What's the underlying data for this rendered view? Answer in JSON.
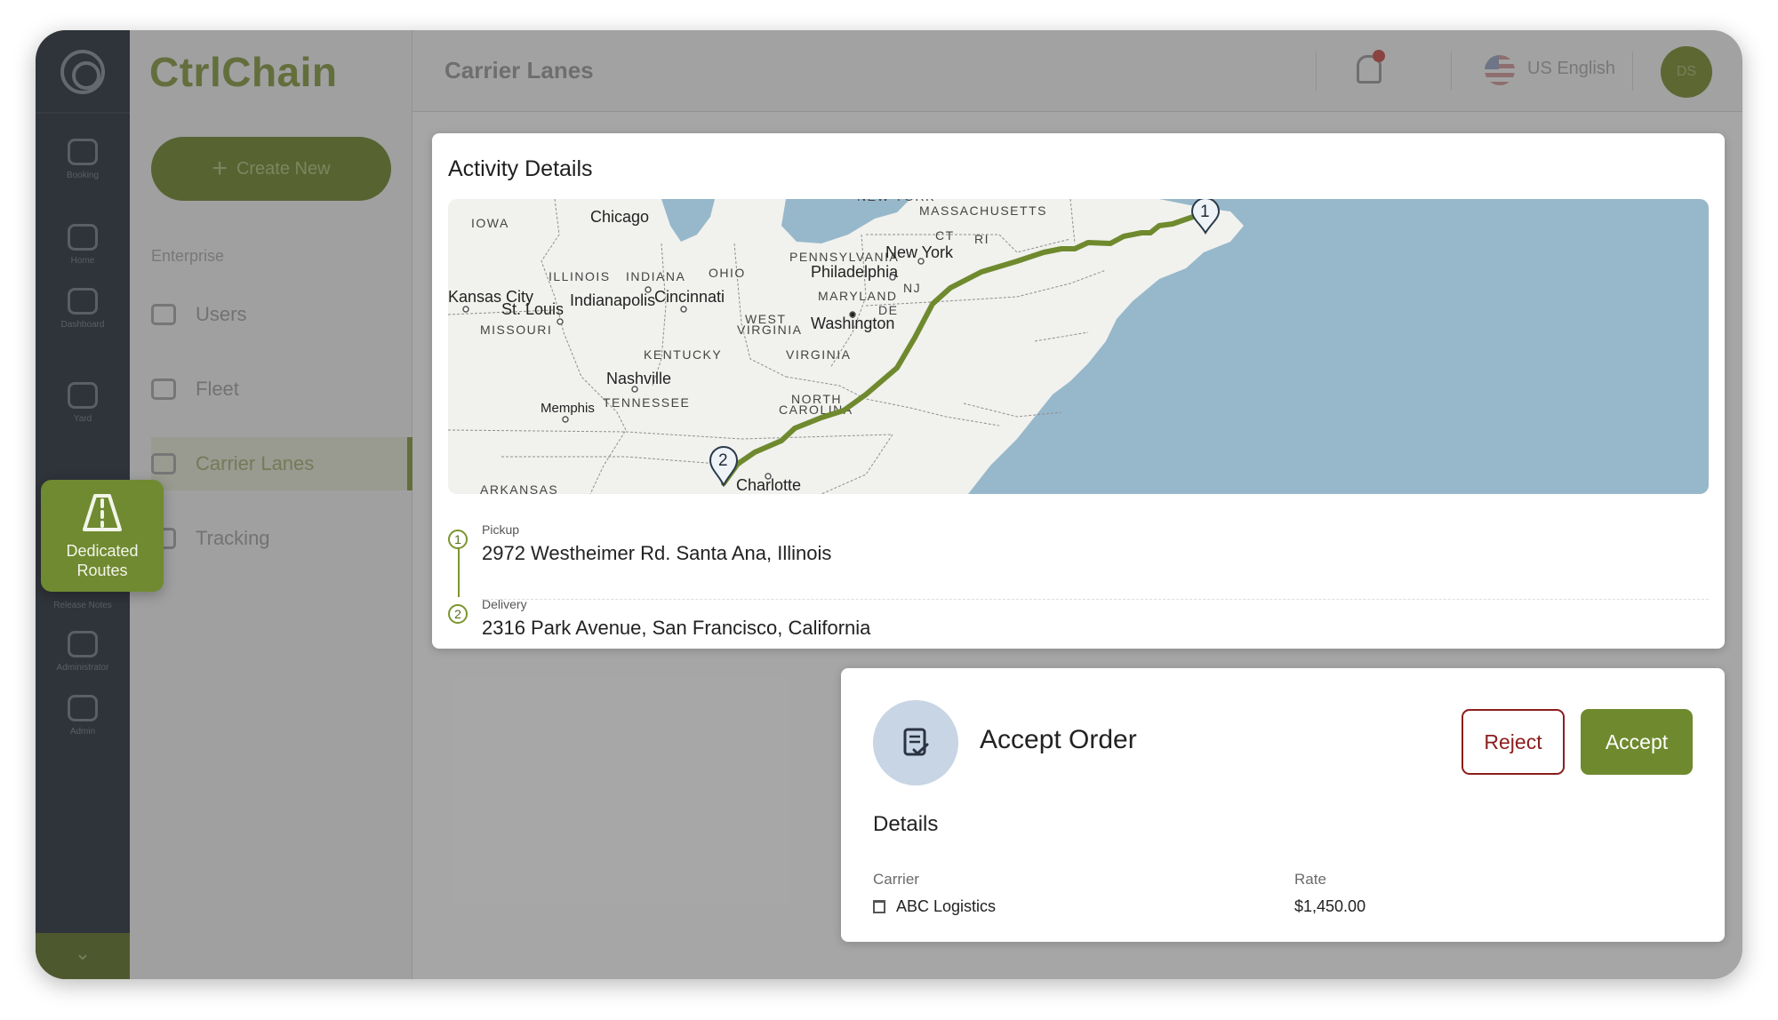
{
  "app": {
    "brand": "CtrlChain",
    "page_title": "Carrier Lanes",
    "language": "US English",
    "avatar_initials": "DS",
    "create_button": "Create New",
    "sidebar_section": "Enterprise",
    "sidebar_items": [
      {
        "label": "Users",
        "icon": "users-icon"
      },
      {
        "label": "Fleet",
        "icon": "truck-icon"
      },
      {
        "label": "Carrier Lanes",
        "icon": "road-icon"
      },
      {
        "label": "Tracking",
        "icon": "location-icon"
      }
    ],
    "rail_items": [
      "Booking",
      "Home",
      "Dashboard",
      "Yard",
      "Dedicated Routes",
      "Release Notes",
      "Administrator",
      "Admin"
    ],
    "active_rail_label": "Dedicated Routes",
    "accent_color": "#6f8a2e"
  },
  "activity": {
    "title": "Activity Details",
    "map": {
      "states": [
        "IOWA",
        "ILLINOIS",
        "INDIANA",
        "OHIO",
        "PENNSYLVANIA",
        "MASSACHUSETTS",
        "CT",
        "RI",
        "NJ",
        "MARYLAND",
        "DE",
        "WEST VIRGINIA",
        "VIRGINIA",
        "KENTUCKY",
        "MISSOURI",
        "TENNESSEE",
        "NORTH CAROLINA",
        "ARKANSAS",
        "NEW YORK"
      ],
      "cities": [
        "Chicago",
        "Indianapolis",
        "Cincinnati",
        "St. Louis",
        "Kansas City",
        "Nashville",
        "Memphis",
        "Charlotte",
        "Philadelphia",
        "New York",
        "Washington"
      ],
      "markers": [
        "1",
        "2"
      ]
    },
    "stops": [
      {
        "num": "1",
        "label": "Pickup",
        "address": "2972 Westheimer Rd. Santa Ana, Illinois"
      },
      {
        "num": "2",
        "label": "Delivery",
        "address": "2316 Park Avenue, San Francisco, California"
      }
    ]
  },
  "order": {
    "title": "Accept Order",
    "reject_label": "Reject",
    "accept_label": "Accept",
    "details_heading": "Details",
    "carrier_label": "Carrier",
    "carrier_value": "ABC Logistics",
    "rate_label": "Rate",
    "rate_value": "$1,450.00"
  }
}
